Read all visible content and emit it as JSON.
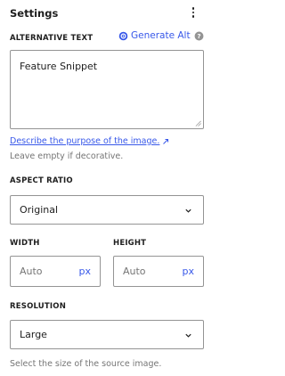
{
  "panel": {
    "title": "Settings"
  },
  "alt_text": {
    "label": "ALTERNATIVE TEXT",
    "generate_label": "Generate Alt",
    "value": "Feature Snippet",
    "describe_link": "Describe the purpose of the image.",
    "hint": "Leave empty if decorative."
  },
  "aspect_ratio": {
    "label": "ASPECT RATIO",
    "selected": "Original"
  },
  "width": {
    "label": "WIDTH",
    "placeholder": "Auto",
    "unit": "px"
  },
  "height": {
    "label": "HEIGHT",
    "placeholder": "Auto",
    "unit": "px"
  },
  "resolution": {
    "label": "RESOLUTION",
    "selected": "Large",
    "hint": "Select the size of the source image."
  },
  "colors": {
    "accent": "#3858e9",
    "border": "#949494",
    "muted_text": "#757575",
    "text": "#1e1e1e"
  },
  "icons": [
    "more-vertical-icon",
    "ai-generate-icon",
    "help-icon",
    "external-link-icon",
    "chevron-down-icon",
    "resize-grip-icon"
  ]
}
